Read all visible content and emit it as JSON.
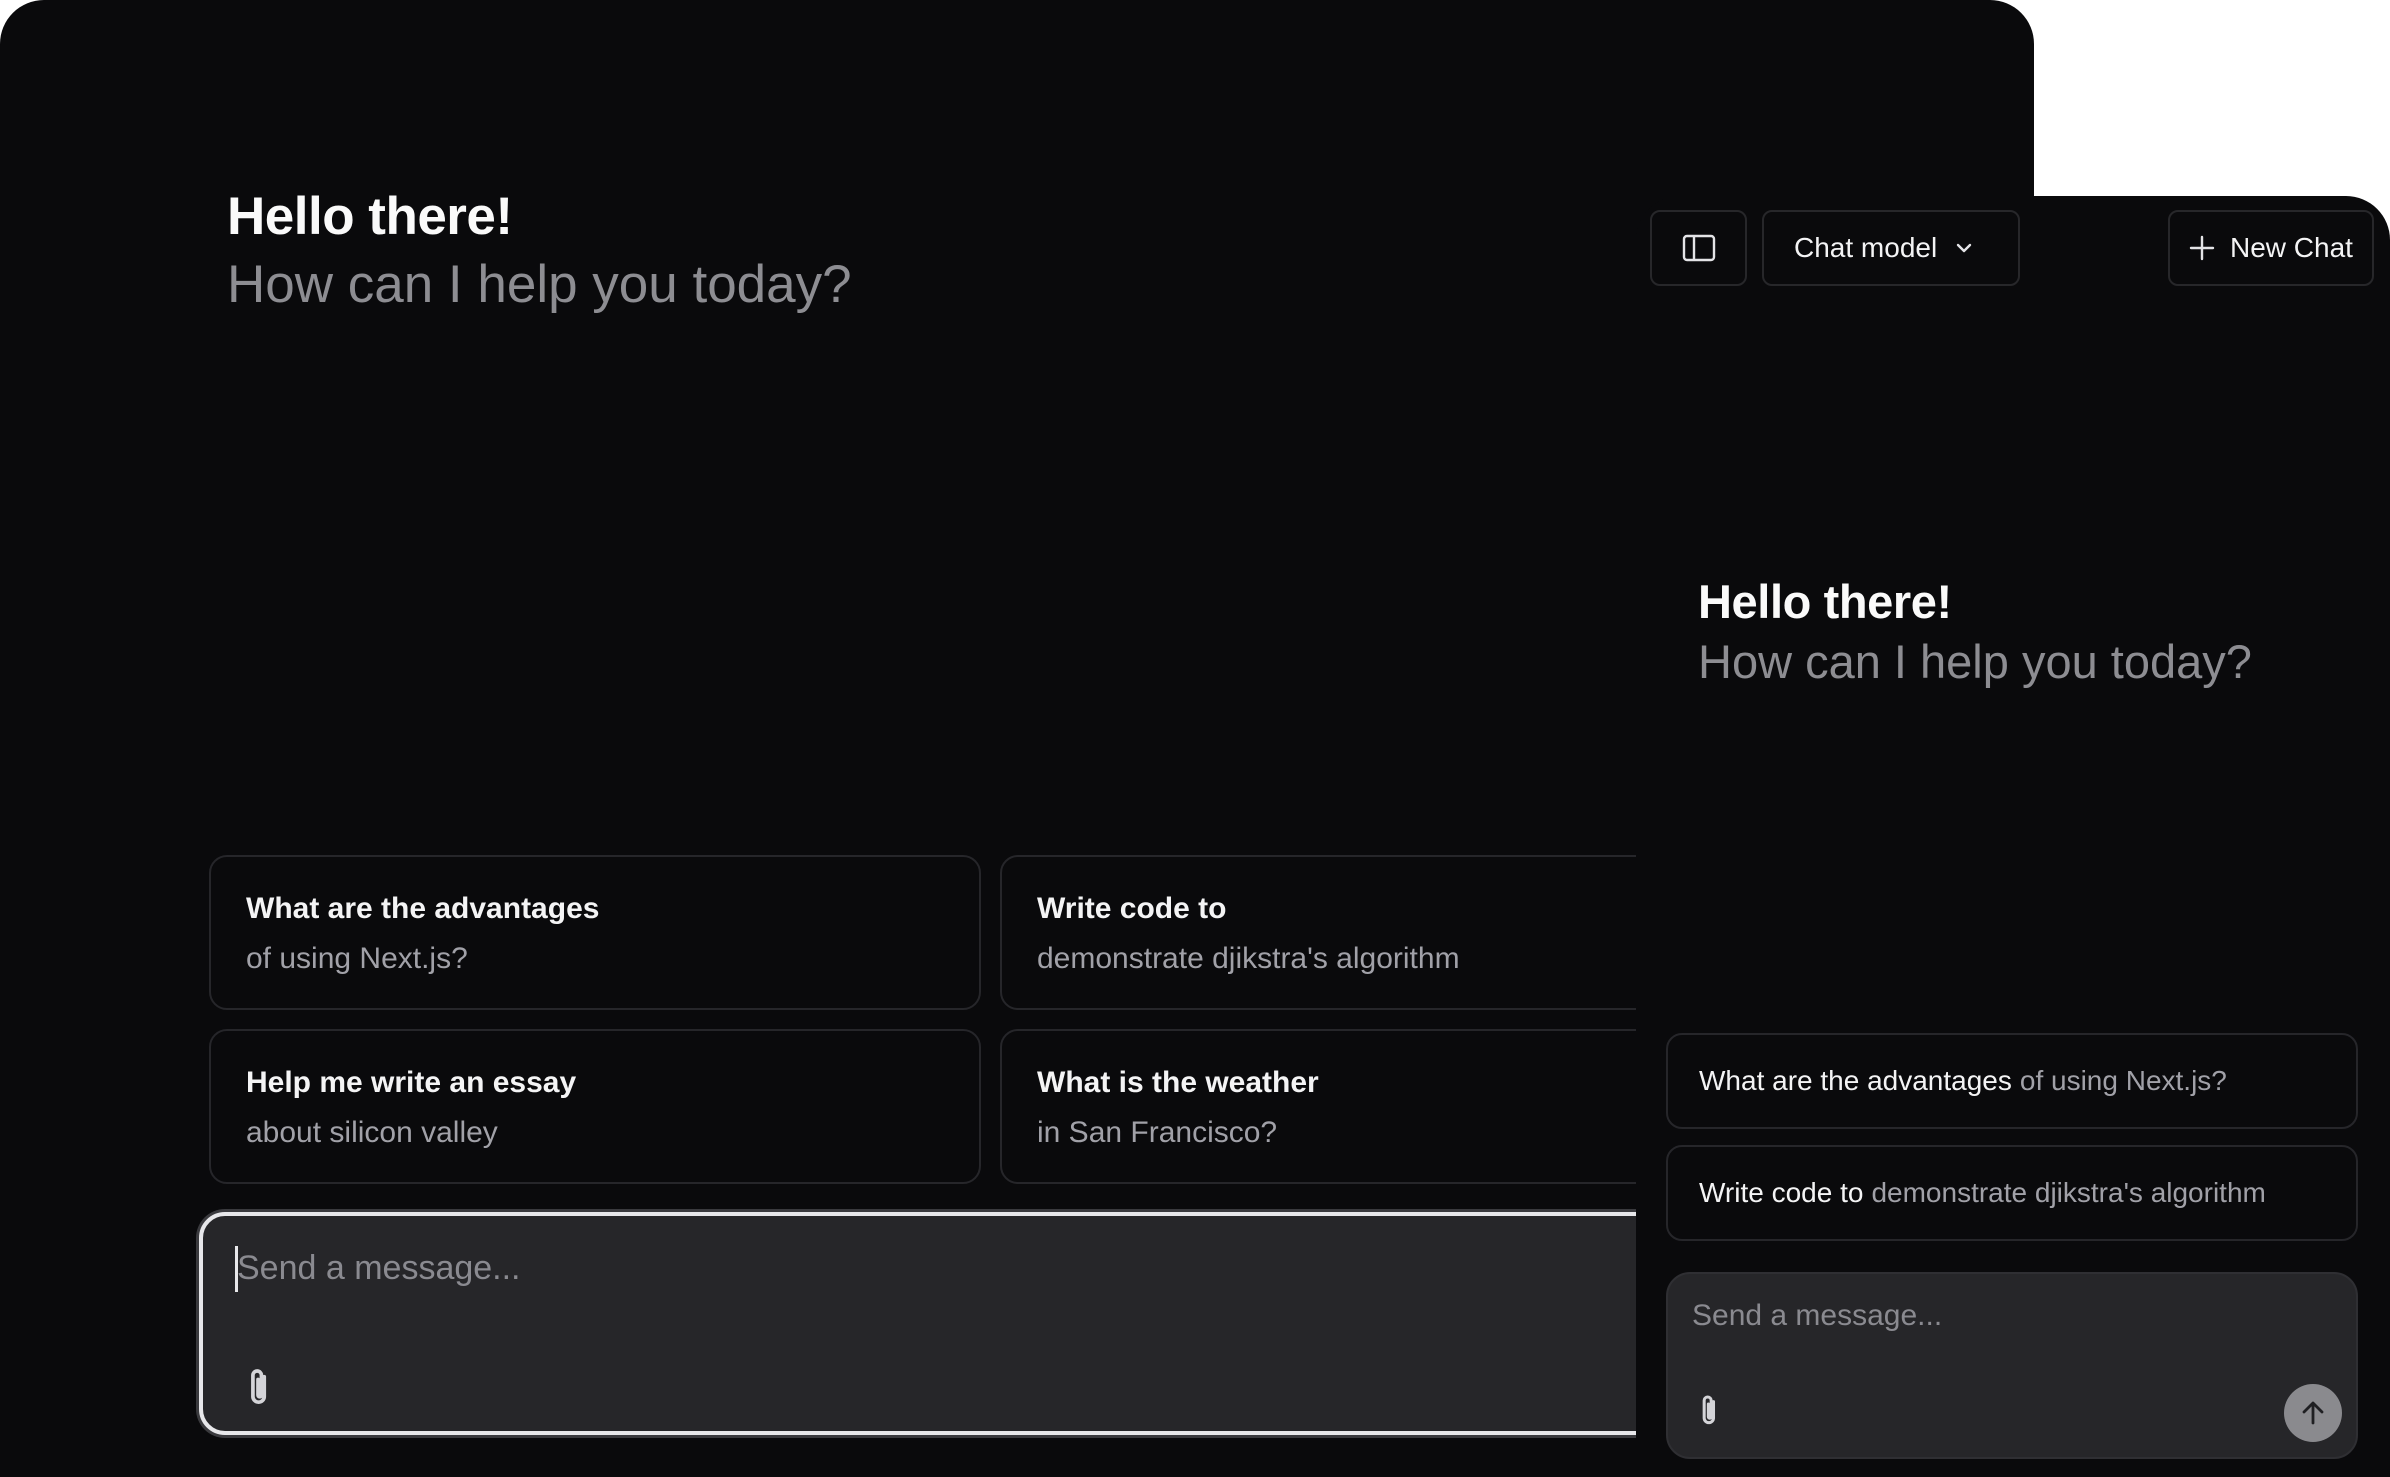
{
  "desktop": {
    "greeting": {
      "title": "Hello there!",
      "subtitle": "How can I help you today?"
    },
    "suggestions": [
      {
        "title": "What are the advantages",
        "detail": "of using Next.js?"
      },
      {
        "title": "Write code to",
        "detail": "demonstrate djikstra's algorithm"
      },
      {
        "title": "Help me write an essay",
        "detail": "about silicon valley"
      },
      {
        "title": "What is the weather",
        "detail": "in San Francisco?"
      }
    ],
    "input": {
      "placeholder": "Send a message...",
      "attach_icon": "paperclip-icon"
    }
  },
  "mobile": {
    "header": {
      "sidebar_icon": "sidebar-toggle-icon",
      "model_label": "Chat model",
      "model_icon": "chevron-down-icon",
      "new_chat_label": "New Chat",
      "new_chat_icon": "plus-icon"
    },
    "greeting": {
      "title": "Hello there!",
      "subtitle": "How can I help you today?"
    },
    "suggestions": [
      {
        "title": "What are the advantages",
        "detail": "of using Next.js?"
      },
      {
        "title": "Write code to",
        "detail": "demonstrate djikstra's algorithm"
      }
    ],
    "input": {
      "placeholder": "Send a message...",
      "attach_icon": "paperclip-icon",
      "send_icon": "arrow-up-icon"
    }
  },
  "colors": {
    "background": "#0a0a0c",
    "input_background": "#262629",
    "card_border": "#26262a",
    "text_primary": "#fafafa",
    "text_muted": "#8d8d92",
    "send_button": "#8a8a8e"
  }
}
